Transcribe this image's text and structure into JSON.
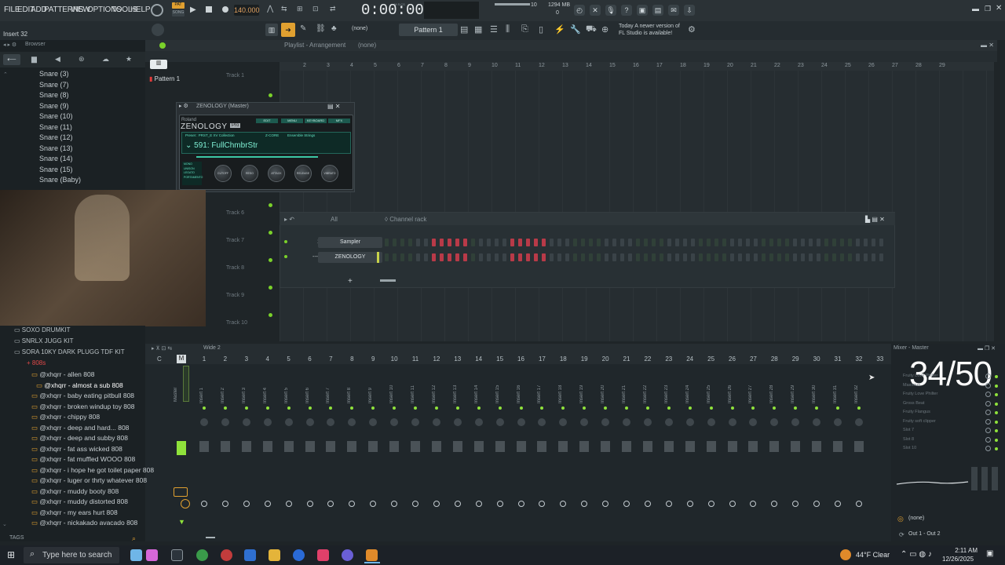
{
  "menu": [
    "FILE",
    "EDIT",
    "ADD",
    "PATTERNS",
    "VIEW",
    "OPTIONS",
    "TOOLS",
    "HELP"
  ],
  "transport": {
    "pat": "PAT",
    "song": "SONG",
    "bpm": "140.000",
    "time": "0:00:00",
    "time_unit": "M:S:CS",
    "cpu": "10",
    "mem": "1294 MB",
    "voices": "0"
  },
  "hint": "Insert 32",
  "toolbar2": {
    "snap": "(none)",
    "pattern": "Pattern 1",
    "news_line1": "Today A newer version of",
    "news_line2": "FL Studio is available!"
  },
  "browser": {
    "title": "Browser",
    "items": [
      "Snare (3)",
      "Snare (7)",
      "Snare (8)",
      "Snare (9)",
      "Snare (10)",
      "Snare (11)",
      "Snare (12)",
      "Snare (13)",
      "Snare (14)",
      "Snare (15)",
      "Snare (Baby)"
    ]
  },
  "playlist": {
    "title": "Playlist - Arrangement",
    "subtitle": "(none)",
    "pattern_item": "Pattern 1",
    "ruler": [
      "2",
      "3",
      "4",
      "5",
      "6",
      "7",
      "8",
      "9",
      "10",
      "11",
      "12",
      "13",
      "14",
      "15",
      "16",
      "17",
      "18",
      "19",
      "20",
      "21",
      "22",
      "23",
      "24",
      "25",
      "26",
      "27",
      "28",
      "29"
    ],
    "tracks": [
      "Track 1",
      "Track 6",
      "Track 7",
      "Track 8",
      "Track 9",
      "Track 10"
    ]
  },
  "zenology": {
    "title": "ZENOLOGY (Master)",
    "brand": "Roland",
    "product": "ZENOLOGY",
    "edition": "Pro",
    "tabs": [
      "EDIT",
      "MENU",
      "KEYBOARD",
      "MFX"
    ],
    "preset_label": "Preset : PRST_E XV Collection",
    "zcore": "Z-CORE",
    "category": "Ensemble Strings",
    "patch": "591:  FullChmbrStr",
    "knobs": [
      "CUTOFF",
      "RESO",
      "ATTACK",
      "RELEASE",
      "VIBRATO"
    ],
    "modes": [
      "MONO",
      "UNISON",
      "LEGATO",
      "PORTAMENTO"
    ]
  },
  "channel_rack": {
    "title": "Channel rack",
    "filter": "All",
    "channels": [
      {
        "num": "1",
        "name": "Sampler"
      },
      {
        "num": "---",
        "name": "ZENOLOGY"
      }
    ]
  },
  "mixer": {
    "title": "Wide 2",
    "master_label": "Master",
    "header_title": "Mixer - Master",
    "numbers": [
      "1",
      "2",
      "3",
      "4",
      "5",
      "6",
      "7",
      "8",
      "9",
      "10",
      "11",
      "12",
      "13",
      "14",
      "15",
      "16",
      "17",
      "18",
      "19",
      "20",
      "21",
      "22",
      "23",
      "24",
      "25",
      "26",
      "27",
      "28",
      "29",
      "30",
      "31",
      "32",
      "33"
    ],
    "fx": [
      "Fruity Love Philter",
      "Maximus",
      "Fruity Love Philter",
      "Gross Beat",
      "Fruity Flangus",
      "Fruity soft clipper",
      "Slot 7",
      "Slot 8",
      "Slot 10"
    ],
    "input": "(none)",
    "output": "Out 1 - Out 2",
    "counter": "34/50"
  },
  "lower_browser": {
    "folders": [
      "SOXO DRUMKIT",
      "SNRLX JUGG KIT",
      "SORA 10KY DARK PLUGG TDF KIT"
    ],
    "subfolder": "808s",
    "items": [
      "@xhqrr - allen 808",
      "@xhqrr - almost a sub 808",
      "@xhqrr - baby eating pitbull 808",
      "@xhqrr - broken windup toy 808",
      "@xhqrr - chippy 808",
      "@xhqrr - deep and hard... 808",
      "@xhqrr - deep and subby 808",
      "@xhqrr - fat ass wicked 808",
      "@xhqrr - fat muffled WOOO 808",
      "@xhqrr - i hope he got toilet paper 808",
      "@xhqrr - luger or thrty whatever 808",
      "@xhqrr - muddy booty 808",
      "@xhqrr - muddy distorted 808",
      "@xhqrr - my ears hurt 808",
      "@xhqrr - nickakado avacado 808"
    ],
    "tags": "TAGS"
  },
  "taskbar": {
    "search": "Type here to search",
    "weather": "44°F  Clear",
    "time": "2:11 AM",
    "date": "12/26/2025"
  }
}
